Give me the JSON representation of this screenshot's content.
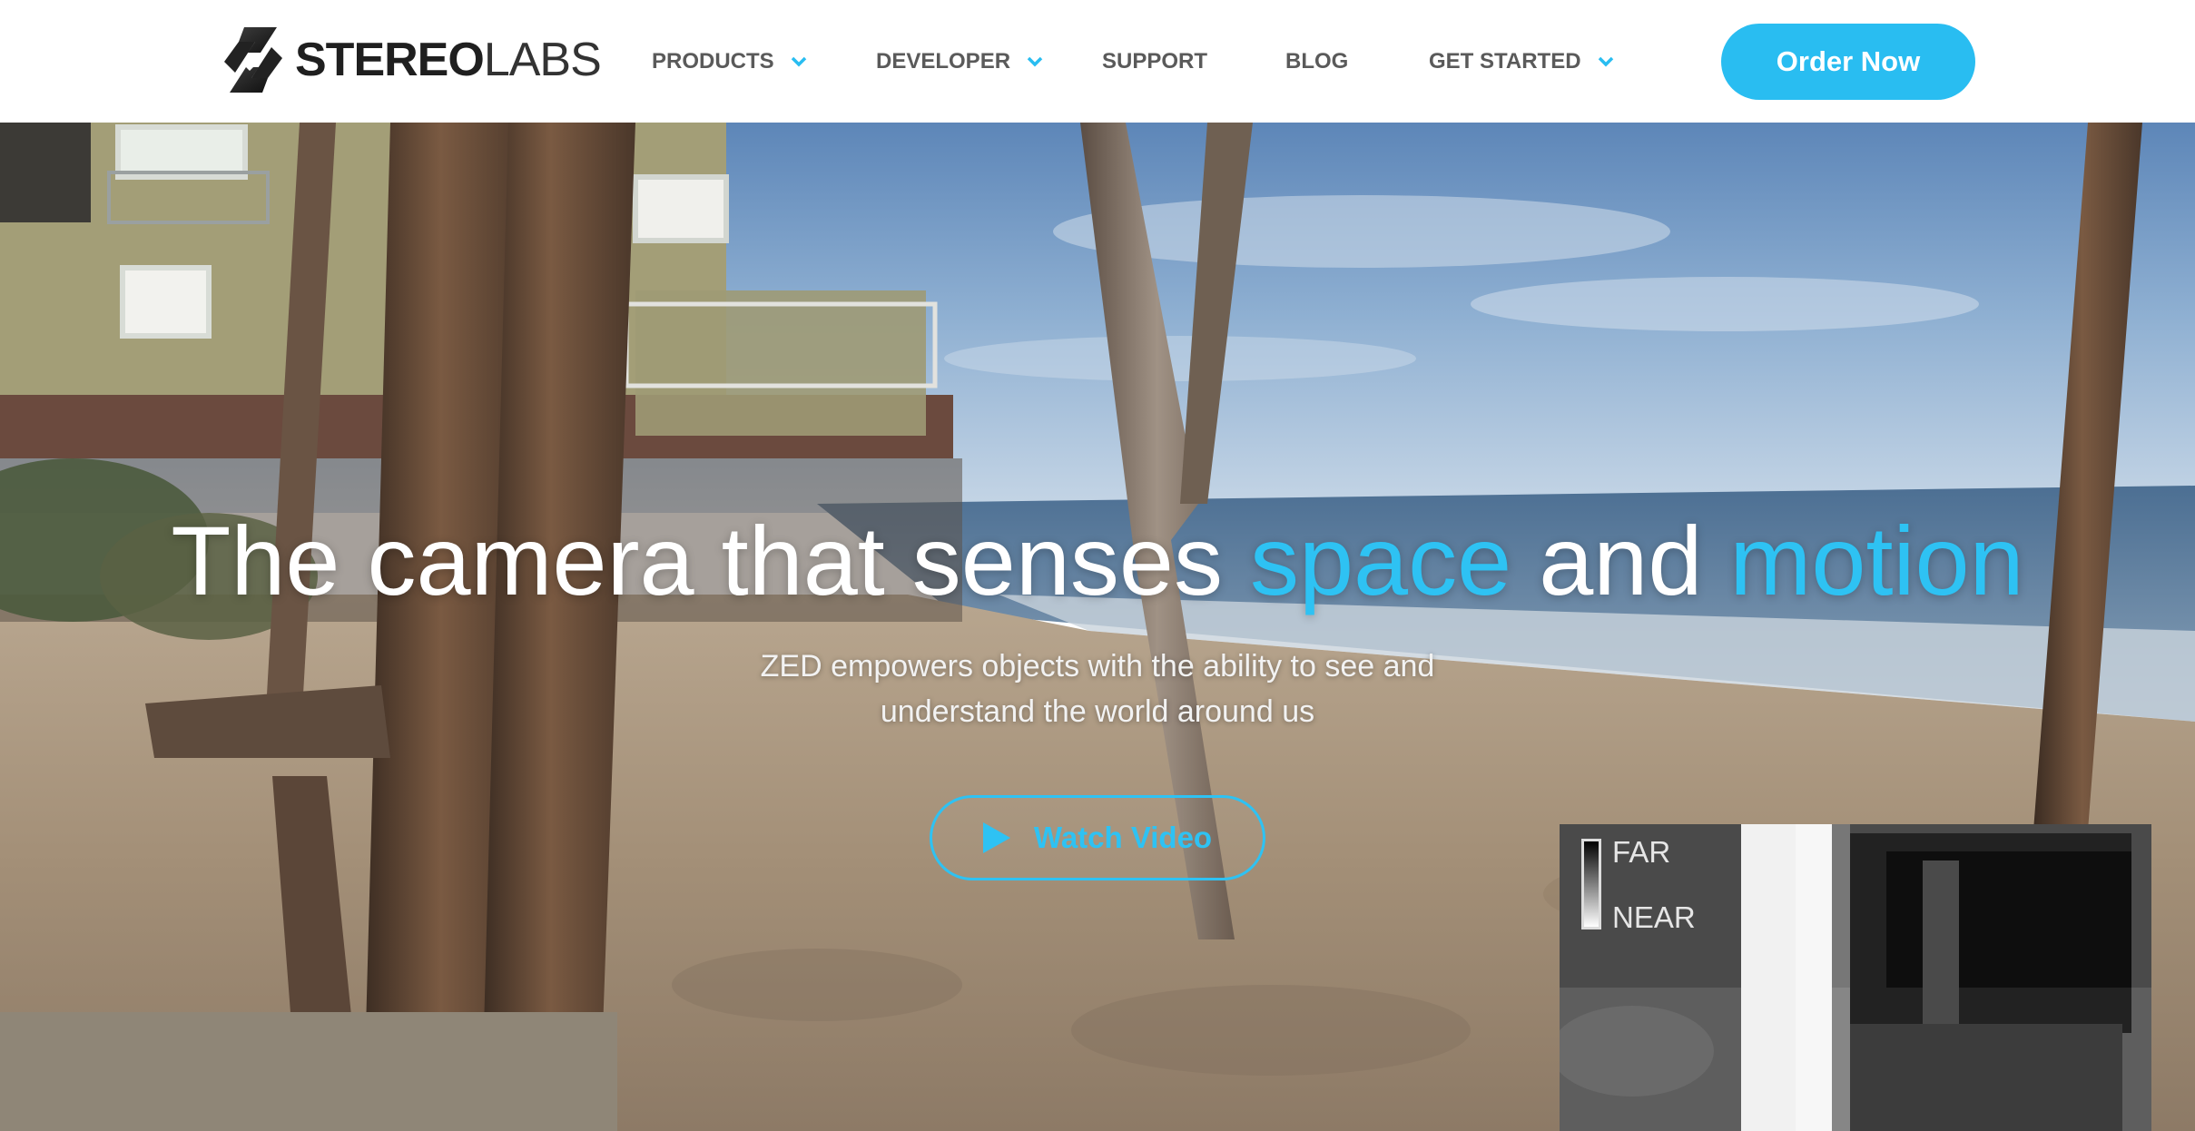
{
  "brand": {
    "logo_bold": "STEREO",
    "logo_light": "LABS",
    "logo_icon": "stereolabs-logo-icon",
    "accent_color": "#29bdf1"
  },
  "nav": {
    "items": [
      {
        "label": "PRODUCTS",
        "dropdown": true
      },
      {
        "label": "DEVELOPER",
        "dropdown": true
      },
      {
        "label": "SUPPORT",
        "dropdown": false
      },
      {
        "label": "BLOG",
        "dropdown": false
      },
      {
        "label": "GET STARTED",
        "dropdown": true
      }
    ],
    "order_button": "Order Now"
  },
  "hero": {
    "headline_part1": "The camera that senses",
    "headline_highlight1": "space",
    "headline_part2": "and",
    "headline_highlight2": "motion",
    "highlight_color": "#2ec2f3",
    "subtitle_line1": "ZED empowers objects with the ability to see and",
    "subtitle_line2": "understand the world around us",
    "watch_button": "Watch Video",
    "watch_icon": "play-icon"
  },
  "depth_map": {
    "legend_far": "FAR",
    "legend_near": "NEAR"
  }
}
